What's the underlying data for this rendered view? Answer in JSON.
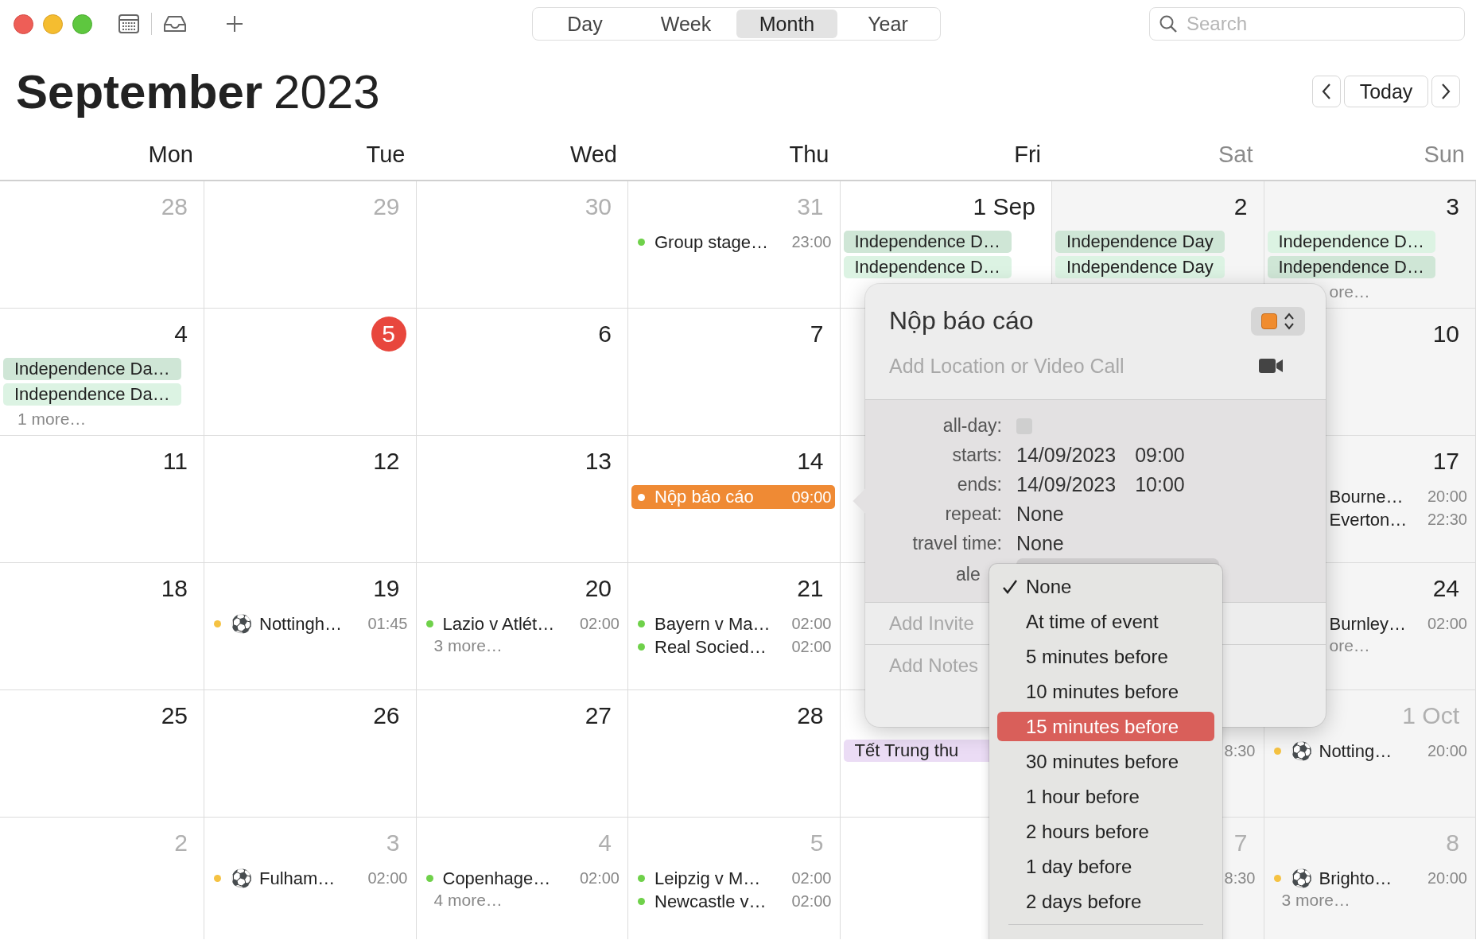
{
  "toolbar": {
    "views": [
      {
        "label": "Day",
        "selected": false
      },
      {
        "label": "Week",
        "selected": false
      },
      {
        "label": "Month",
        "selected": true
      },
      {
        "label": "Year",
        "selected": false
      }
    ],
    "search": {
      "placeholder": "Search"
    }
  },
  "header": {
    "month": "September",
    "year": "2023",
    "today_button": "Today"
  },
  "weekdays": [
    {
      "label": "Mon",
      "weekend": false
    },
    {
      "label": "Tue",
      "weekend": false
    },
    {
      "label": "Wed",
      "weekend": false
    },
    {
      "label": "Thu",
      "weekend": false
    },
    {
      "label": "Fri",
      "weekend": false
    },
    {
      "label": "Sat",
      "weekend": true
    },
    {
      "label": "Sun",
      "weekend": true
    }
  ],
  "weeks": [
    [
      {
        "day": "28",
        "muted": true,
        "today": false
      },
      {
        "day": "29",
        "muted": true,
        "today": false
      },
      {
        "day": "30",
        "muted": true,
        "today": false
      },
      {
        "day": "31",
        "muted": true,
        "today": false,
        "events": [
          {
            "kind": "timed",
            "title": "Group stage…",
            "time": "23:00",
            "color": "#6fd14a",
            "selected": false
          }
        ]
      },
      {
        "day": "1 Sep",
        "muted": false,
        "today": false,
        "events": [
          {
            "kind": "allday",
            "title": "Independence D…",
            "color": "#cfe6d6"
          },
          {
            "kind": "allday",
            "title": "Independence D…",
            "color": "#dcf3e3"
          }
        ]
      },
      {
        "day": "2",
        "muted": false,
        "today": false,
        "events": [
          {
            "kind": "allday",
            "title": "Independence Day",
            "color": "#cfe6d6"
          },
          {
            "kind": "allday",
            "title": "Independence Day",
            "color": "#dcf3e3"
          }
        ]
      },
      {
        "day": "3",
        "muted": false,
        "today": false,
        "events": [
          {
            "kind": "allday",
            "title": "Independence D…",
            "color": "#dcf3e3"
          },
          {
            "kind": "allday",
            "title": "Independence D…",
            "color": "#cfe6d6"
          },
          {
            "kind": "covered_more",
            "title": "ore…"
          }
        ]
      }
    ],
    [
      {
        "day": "4",
        "muted": false,
        "today": false,
        "events": [
          {
            "kind": "allday",
            "title": "Independence Da…",
            "color": "#cfe6d6"
          },
          {
            "kind": "allday",
            "title": "Independence Da…",
            "color": "#dcf3e3"
          },
          {
            "kind": "more",
            "title": "1 more…"
          }
        ]
      },
      {
        "day": "5",
        "muted": false,
        "today": true
      },
      {
        "day": "6",
        "muted": false,
        "today": false
      },
      {
        "day": "7",
        "muted": false,
        "today": false
      },
      {
        "day": "10",
        "muted": false,
        "today": false
      }
    ],
    [
      {
        "day": "11",
        "muted": false,
        "today": false
      },
      {
        "day": "12",
        "muted": false,
        "today": false
      },
      {
        "day": "13",
        "muted": false,
        "today": false
      },
      {
        "day": "14",
        "muted": false,
        "today": false,
        "events": [
          {
            "kind": "timed",
            "title": "Nộp báo cáo",
            "time": "09:00",
            "color": "#ef8a34",
            "selected": true
          }
        ]
      },
      {
        "day": "17",
        "muted": false,
        "today": false,
        "events": [
          {
            "kind": "covered",
            "title": "Bourne…",
            "time": "20:00"
          },
          {
            "kind": "covered",
            "title": "Everton…",
            "time": "22:30"
          }
        ]
      }
    ],
    [
      {
        "day": "18",
        "muted": false,
        "today": false
      },
      {
        "day": "19",
        "muted": false,
        "today": false,
        "events": [
          {
            "kind": "timed",
            "emoji": "⚽",
            "title": "Nottingh…",
            "time": "01:45",
            "color": "#f5c242",
            "selected": false
          }
        ]
      },
      {
        "day": "20",
        "muted": false,
        "today": false,
        "events": [
          {
            "kind": "timed",
            "title": "Lazio v Atlét…",
            "time": "02:00",
            "color": "#6fd14a",
            "selected": false
          },
          {
            "kind": "more",
            "title": "3 more…"
          }
        ]
      },
      {
        "day": "21",
        "muted": false,
        "today": false,
        "events": [
          {
            "kind": "timed",
            "title": "Bayern v Ma…",
            "time": "02:00",
            "color": "#6fd14a",
            "selected": false
          },
          {
            "kind": "timed",
            "title": "Real Socied…",
            "time": "02:00",
            "color": "#6fd14a",
            "selected": false
          }
        ]
      },
      {
        "day": "24",
        "muted": false,
        "today": false,
        "events": [
          {
            "kind": "covered",
            "title": "Burnley…",
            "time": "02:00"
          },
          {
            "kind": "covered_more",
            "title": "ore…"
          }
        ]
      }
    ],
    [
      {
        "day": "25",
        "muted": false,
        "today": false
      },
      {
        "day": "26",
        "muted": false,
        "today": false
      },
      {
        "day": "27",
        "muted": false,
        "today": false
      },
      {
        "day": "28",
        "muted": false,
        "today": false
      },
      {
        "events": [
          {
            "kind": "allday",
            "title": "Tết Trung thu",
            "color": "#ebdcf5"
          }
        ]
      },
      {
        "events": [
          {
            "kind": "time_only",
            "time": "8:30"
          }
        ]
      },
      {
        "day": "1 Oct",
        "muted": true,
        "today": false,
        "events": [
          {
            "kind": "timed",
            "emoji": "⚽",
            "title": "Notting…",
            "time": "20:00",
            "color": "#f5c242",
            "selected": false
          }
        ]
      }
    ],
    [
      {
        "day": "2",
        "muted": true,
        "today": false
      },
      {
        "day": "3",
        "muted": true,
        "today": false,
        "events": [
          {
            "kind": "timed",
            "emoji": "⚽",
            "title": "Fulham…",
            "time": "02:00",
            "color": "#f5c242",
            "selected": false
          }
        ]
      },
      {
        "day": "4",
        "muted": true,
        "today": false,
        "events": [
          {
            "kind": "timed",
            "title": "Copenhage…",
            "time": "02:00",
            "color": "#6fd14a",
            "selected": false
          },
          {
            "kind": "more",
            "title": "4 more…"
          }
        ]
      },
      {
        "day": "5",
        "muted": true,
        "today": false,
        "events": [
          {
            "kind": "timed",
            "title": "Leipzig v M…",
            "time": "02:00",
            "color": "#6fd14a",
            "selected": false
          },
          {
            "kind": "timed",
            "title": "Newcastle v…",
            "time": "02:00",
            "color": "#6fd14a",
            "selected": false
          }
        ]
      },
      {
        "day": "7",
        "muted": true,
        "today": false,
        "events": [
          {
            "kind": "time_only",
            "time": "8:30"
          }
        ]
      },
      {
        "day": "8",
        "muted": true,
        "today": false,
        "events": [
          {
            "kind": "timed",
            "emoji": "⚽",
            "title": "Brighto…",
            "time": "20:00",
            "color": "#f5c242",
            "selected": false
          },
          {
            "kind": "more",
            "title": "3 more…"
          }
        ]
      }
    ]
  ],
  "popover": {
    "title": "Nộp báo cáo",
    "color": "#f08c2e",
    "location_placeholder": "Add Location or Video Call",
    "fields": [
      {
        "kind": "checkbox",
        "label": "all-day:",
        "checked": false
      },
      {
        "kind": "datetime",
        "label": "starts:",
        "date": "14/09/2023",
        "time": "09:00"
      },
      {
        "kind": "datetime",
        "label": "ends:",
        "date": "14/09/2023",
        "time": "10:00"
      },
      {
        "kind": "text",
        "label": "repeat:",
        "value": "None"
      },
      {
        "kind": "text",
        "label": "travel time:",
        "value": "None"
      },
      {
        "kind": "popup",
        "label": "ale"
      }
    ],
    "invitees_placeholder": "Add Invite",
    "notes_placeholder": "Add Notes"
  },
  "alert_menu": [
    {
      "label": "None",
      "checked": true,
      "selected": false
    },
    {
      "label": "At time of event",
      "checked": false,
      "selected": false
    },
    {
      "label": "5 minutes before",
      "checked": false,
      "selected": false
    },
    {
      "label": "10 minutes before",
      "checked": false,
      "selected": false
    },
    {
      "label": "15 minutes before",
      "checked": false,
      "selected": true
    },
    {
      "label": "30 minutes before",
      "checked": false,
      "selected": false
    },
    {
      "label": "1 hour before",
      "checked": false,
      "selected": false
    },
    {
      "label": "2 hours before",
      "checked": false,
      "selected": false
    },
    {
      "label": "1 day before",
      "checked": false,
      "selected": false
    },
    {
      "label": "2 days before",
      "checked": false,
      "selected": false
    }
  ]
}
